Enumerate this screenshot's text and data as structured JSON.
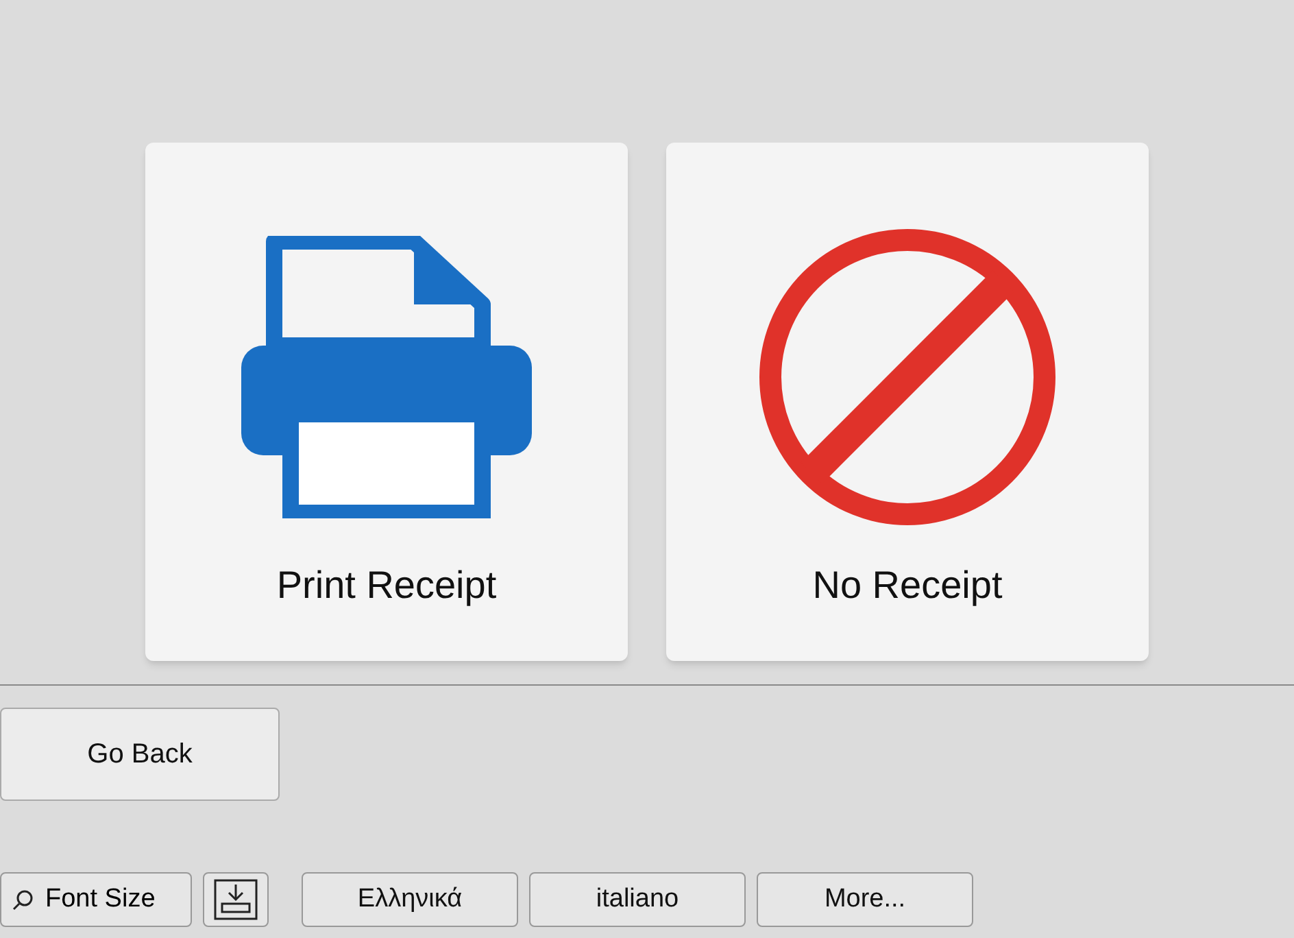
{
  "options": [
    {
      "kind": "print",
      "label": "Print Receipt"
    },
    {
      "kind": "none",
      "label": "No Receipt"
    }
  ],
  "back_button": {
    "label": "Go Back"
  },
  "bottom_bar": {
    "font_size": {
      "label": "Font Size"
    },
    "languages": [
      {
        "label": "Ελληνικά"
      },
      {
        "label": "italiano"
      },
      {
        "label": "More..."
      }
    ]
  }
}
